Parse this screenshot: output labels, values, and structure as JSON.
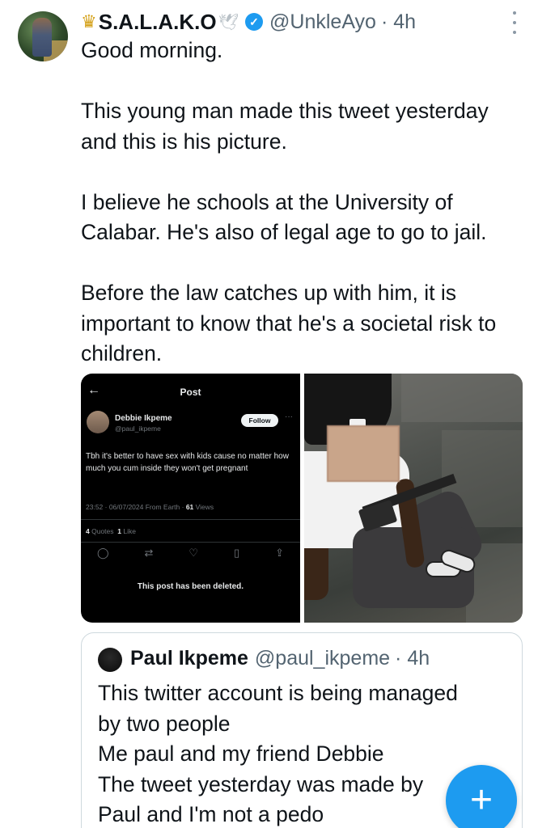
{
  "tweet": {
    "name": "S.A.L.A.K.O",
    "crown_icon": "crown",
    "dove_icon": "dove",
    "handle": "@UnkleAyo",
    "time": "· 4h",
    "paragraphs": [
      "Good morning.",
      "This young man made this tweet yesterday and this is his picture.",
      "I believe he schools at the University of Calabar. He's also of legal age to go to jail.",
      "Before the law catches up with him, it is important to know that he's a societal risk to children."
    ]
  },
  "screenshot": {
    "title": "Post",
    "author": "Debbie Ikpeme",
    "handle": "@paul_ikpeme",
    "follow": "Follow",
    "text": "Tbh it's better to have sex with kids cause no matter how much you cum inside they won't get pregnant",
    "meta": "23:52 · 06/07/2024 From Earth ·",
    "views_count": "61",
    "views_label": "Views",
    "quotes_count": "4",
    "quotes_label": "Quotes",
    "likes_count": "1",
    "likes_label": "Like",
    "deleted": "This post has been deleted."
  },
  "quoted": {
    "name": "Paul Ikpeme",
    "handle": "@paul_ikpeme",
    "time": "· 4h",
    "lines": [
      "This twitter account is being managed",
      "by two people",
      "Me paul and my friend Debbie",
      "The tweet yesterday was made by",
      "Paul and I'm not a pedo"
    ]
  },
  "fab": {
    "label": "+"
  },
  "colors": {
    "accent": "#1d9bf0",
    "secondary_text": "#536471",
    "border": "#cfd9de"
  }
}
